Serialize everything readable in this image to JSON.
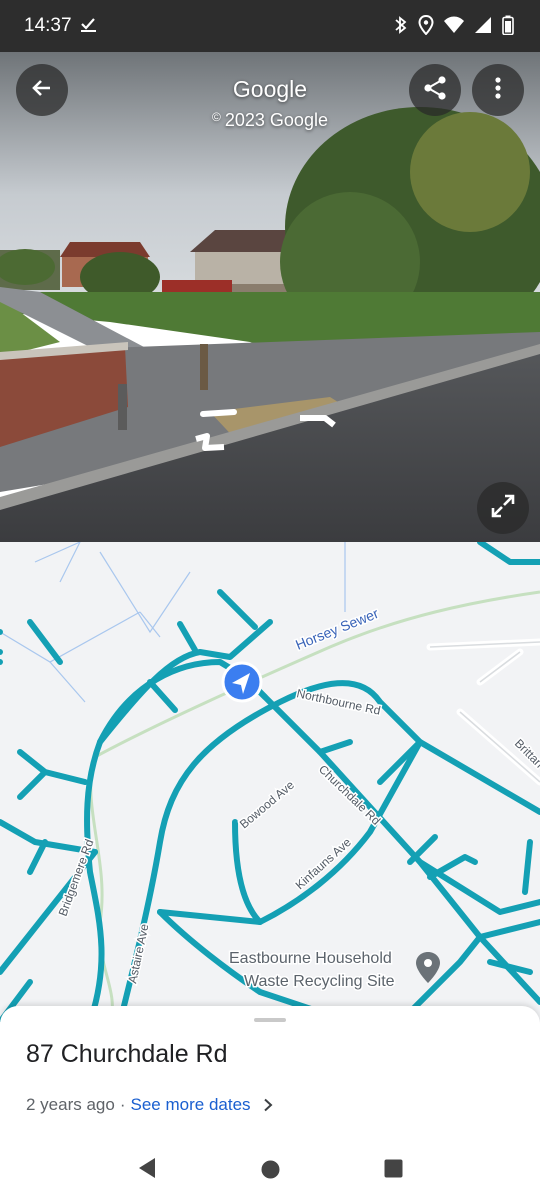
{
  "status_bar": {
    "time": "14:37"
  },
  "street_view": {
    "title": "Google",
    "copyright_symbol": "©",
    "copyright_text": "2023 Google",
    "icons": {
      "back": "arrow-left-icon",
      "share": "share-icon",
      "more": "more-vert-icon",
      "expand": "expand-icon"
    }
  },
  "map": {
    "labels": {
      "waterway": "Horsey Sewer",
      "road_northbourne": "Northbourne Rd",
      "road_churchdale": "Churchdale Rd",
      "road_bowood": "Bowood Ave",
      "road_kinfauns": "Kinfauns Ave",
      "road_bridgemere": "Bridgemere Rd",
      "road_astaire": "Astaire Ave",
      "road_britten": "Brittan",
      "poi_line1": "Eastbourne Household",
      "poi_line2": "Waste Recycling Site"
    },
    "colors": {
      "road": "#14a0b4",
      "background": "#f2f3f5",
      "waterway": "#a9c7ee",
      "location": "#3b7ef0"
    }
  },
  "bottom_sheet": {
    "title": "87 Churchdale Rd",
    "age": "2 years ago",
    "separator": "·",
    "more_dates": "See more dates"
  }
}
